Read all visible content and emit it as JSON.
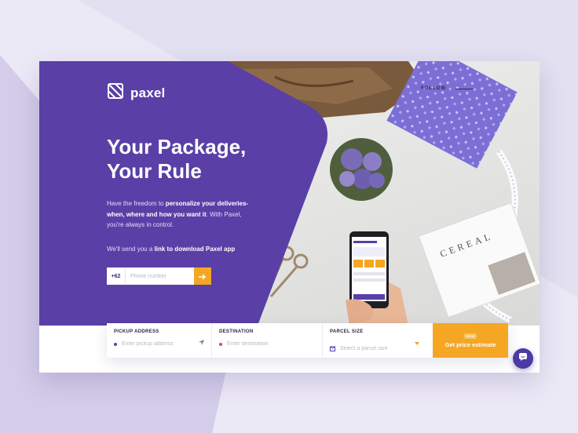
{
  "brand": {
    "name": "paxel"
  },
  "hero": {
    "title_line1": "Your Package,",
    "title_line2": "Your Rule",
    "desc_part1": "Have the freedom to ",
    "desc_bold": "personalize your deliveries-when, where and how you want it",
    "desc_part2": ". With Paxel, you're always in control.",
    "link_part1": "We'll send you a ",
    "link_bold": "link to download Paxel app"
  },
  "phone_form": {
    "prefix": "+62",
    "placeholder": "Phone number"
  },
  "social": {
    "follow_label": "FOLLOW"
  },
  "search": {
    "pickup_label": "PICKUP ADDRESS",
    "pickup_placeholder": "Enter pickup address",
    "destination_label": "DESTINATION",
    "destination_placeholder": "Enter destination",
    "size_label": "PARCEL SIZE",
    "size_placeholder": "Select a parcel size",
    "cta_badge": "NEW",
    "cta_label": "Get price estimate"
  },
  "colors": {
    "primary": "#5a3fa6",
    "accent": "#f5a623",
    "background": "#ece9f6"
  },
  "icons": {
    "logo": "box-logo-icon",
    "arrow": "arrow-right-icon",
    "locate": "locate-arrow-icon",
    "chevron": "chevron-down-icon",
    "parcel": "parcel-icon",
    "chat": "chat-icon"
  }
}
